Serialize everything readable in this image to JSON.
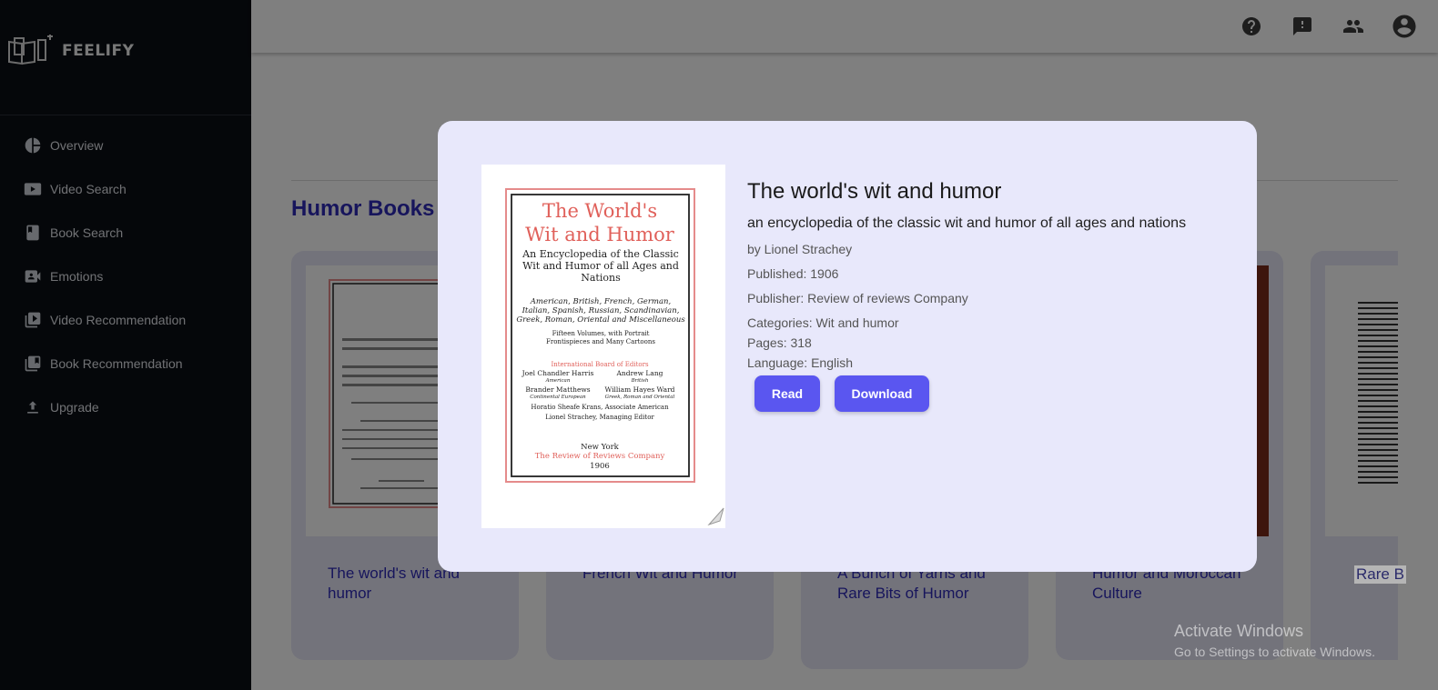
{
  "app": {
    "name": "FEELIFY"
  },
  "sidebar": {
    "items": [
      {
        "label": "Overview",
        "icon": "pie-chart-icon"
      },
      {
        "label": "Video Search",
        "icon": "video-icon"
      },
      {
        "label": "Book Search",
        "icon": "book-icon"
      },
      {
        "label": "Emotions",
        "icon": "camera-icon"
      },
      {
        "label": "Video Recommendation",
        "icon": "video-library-icon"
      },
      {
        "label": "Book Recommendation",
        "icon": "book-library-icon"
      },
      {
        "label": "Upgrade",
        "icon": "upload-icon"
      }
    ]
  },
  "topbar": {
    "icons": [
      "help-icon",
      "feedback-icon",
      "people-icon",
      "account-icon"
    ]
  },
  "main": {
    "section_title": "Humor Books",
    "cards": [
      {
        "title": "The world's wit and humor"
      },
      {
        "title": "French Wit and Humor"
      },
      {
        "title": "A Bunch of Yarns and Rare Bits of Humor"
      },
      {
        "title": "Humor and Moroccan Culture"
      },
      {
        "title": "Rare B"
      }
    ]
  },
  "modal": {
    "title": "The world's wit and humor",
    "subtitle": "an encyclopedia of the classic wit and humor of all ages and nations",
    "author": "by Lionel Strachey",
    "published": "Published: 1906",
    "publisher": "Publisher: Review of reviews Company",
    "categories": "Categories: Wit and humor",
    "pages": "Pages: 318",
    "language": "Language: English",
    "read_label": "Read",
    "download_label": "Download",
    "cover": {
      "heading_line1": "The World's",
      "heading_line2": "Wit and Humor",
      "subheading": "An Encyclopedia of the Classic Wit and Humor of all Ages and Nations",
      "origins": "American, British, French, German, Italian, Spanish, Russian, Scandinavian, Greek, Roman, Oriental and Miscellaneous",
      "volumes": "Fifteen Volumes, with Portrait Frontispieces and Many Cartoons",
      "board_title": "International Board of Editors",
      "editor1": "Joel Chandler Harris",
      "editor1_note": "American",
      "editor2": "Andrew Lang",
      "editor2_note": "British",
      "editor3": "Brander Matthews",
      "editor3_note": "Continental European",
      "editor4": "William Hayes Ward",
      "editor4_note": "Greek, Roman and Oriental",
      "editor5": "Horatio Sheafe Krans, Associate American",
      "editor6": "Lionel Strachey, Managing Editor",
      "city": "New York",
      "company": "The Review of Reviews Company",
      "year": "1906"
    }
  },
  "watermark": {
    "line1": "Activate Windows",
    "line2": "Go to Settings to activate Windows."
  },
  "colors": {
    "accent": "#5a56f0",
    "link": "#2e2ab8",
    "sidebar_bg": "#0b0e14",
    "modal_bg": "#e8e8fb"
  }
}
